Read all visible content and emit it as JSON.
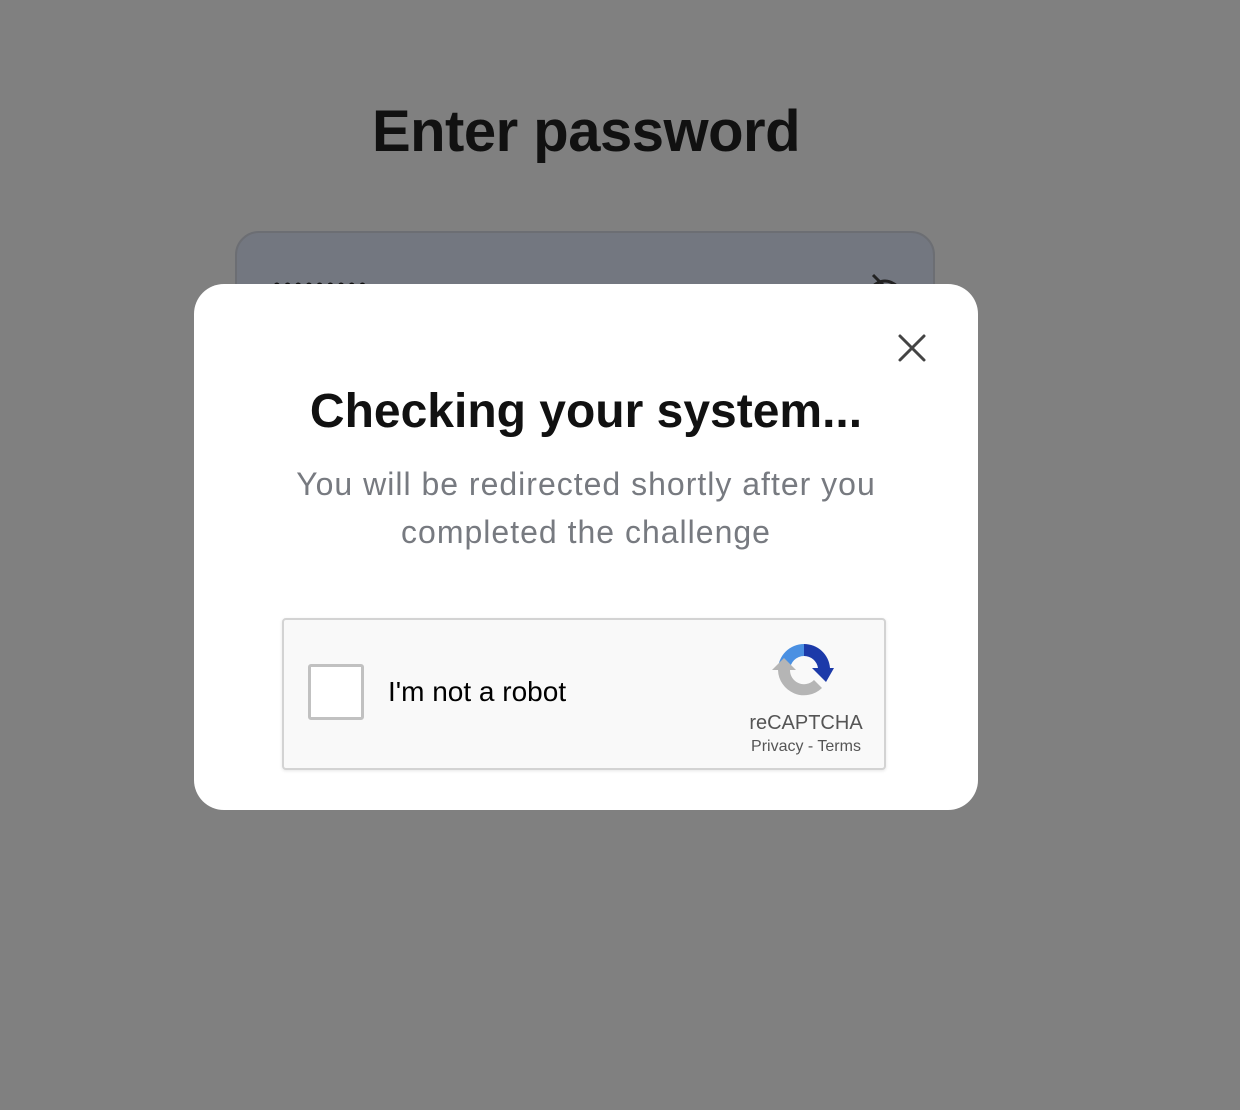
{
  "page": {
    "title": "Enter password",
    "password_masked": "•••••••••"
  },
  "modal": {
    "title": "Checking your system...",
    "subtitle": "You will be redirected shortly after you completed the challenge",
    "captcha": {
      "label": "I'm not a robot",
      "brand": "reCAPTCHA",
      "privacy": "Privacy",
      "separator": " - ",
      "terms": "Terms",
      "checked": false
    }
  }
}
